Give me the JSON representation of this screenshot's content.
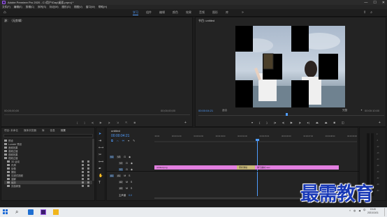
{
  "window": {
    "title": "Adobe Premiere Pro 2020 - C:\\用户\\Day\\桌面.prproj *",
    "controls": [
      "—",
      "☐",
      "✕"
    ]
  },
  "menu": [
    "文件(F)",
    "编辑(E)",
    "剪辑(C)",
    "序列(S)",
    "标记(M)",
    "图形(G)",
    "视图(V)",
    "窗口(W)",
    "帮助(H)"
  ],
  "workspaces": {
    "tabs": [
      "学习",
      "组件",
      "编辑",
      "颜色",
      "效果",
      "音频",
      "图形",
      "库"
    ],
    "active_index": 0,
    "more": "»"
  },
  "source_panel": {
    "tab": "源：（无剪辑）",
    "timecode_left": "00;00;00;00",
    "timecode_right": "00;00;00;00"
  },
  "program_panel": {
    "tab": "节目: untitled",
    "timecode_current": "00:00:04:21",
    "fit_label": "适合",
    "quality": "完整",
    "timecode_total": "00:00:10:00"
  },
  "project_panel": {
    "tabs": [
      "项目: 未命名",
      "媒体浏览器",
      "库",
      "信息",
      "效果"
    ],
    "active_tab_index": 2,
    "items": [
      "预设",
      "Lumetri 预设",
      "音频效果",
      "音频过渡",
      "视频效果",
      "视频过渡",
      "3D 运动",
      "内滑",
      "划像",
      "擦除",
      "沉浸式视频",
      "溶解",
      "缩放",
      "页面剥落"
    ]
  },
  "timeline": {
    "tab": "untitled",
    "timecode": "00:00:04:21",
    "ruler": [
      ":00:00",
      "00:00:01:00",
      "00:00:02:00",
      "00:00:03:00",
      "00:00:04:00",
      "00:00:05:00",
      "00:00:06:00",
      "00:00:07:00",
      "00:00:08:00",
      "00:00:09:00"
    ],
    "tracks": [
      "V3",
      "V2",
      "V1",
      "A1",
      "A2",
      "A3"
    ],
    "master_label": "主声道",
    "master_value": "0.0",
    "clips": [
      {
        "name": "untitled.png",
        "track": "V1"
      },
      {
        "name": "带状滑动",
        "track": "V1"
      },
      {
        "name": "学习素材.mov",
        "track": "V1"
      }
    ]
  },
  "taskbar": {
    "time": "19:45",
    "date": "2021/10/11",
    "language": "中"
  },
  "watermark": "最需教育",
  "colors": {
    "accent": "#4f9dff",
    "clip_pink": "#e27fe0",
    "transition": "#c9b879",
    "watermark": "#1939b7"
  }
}
